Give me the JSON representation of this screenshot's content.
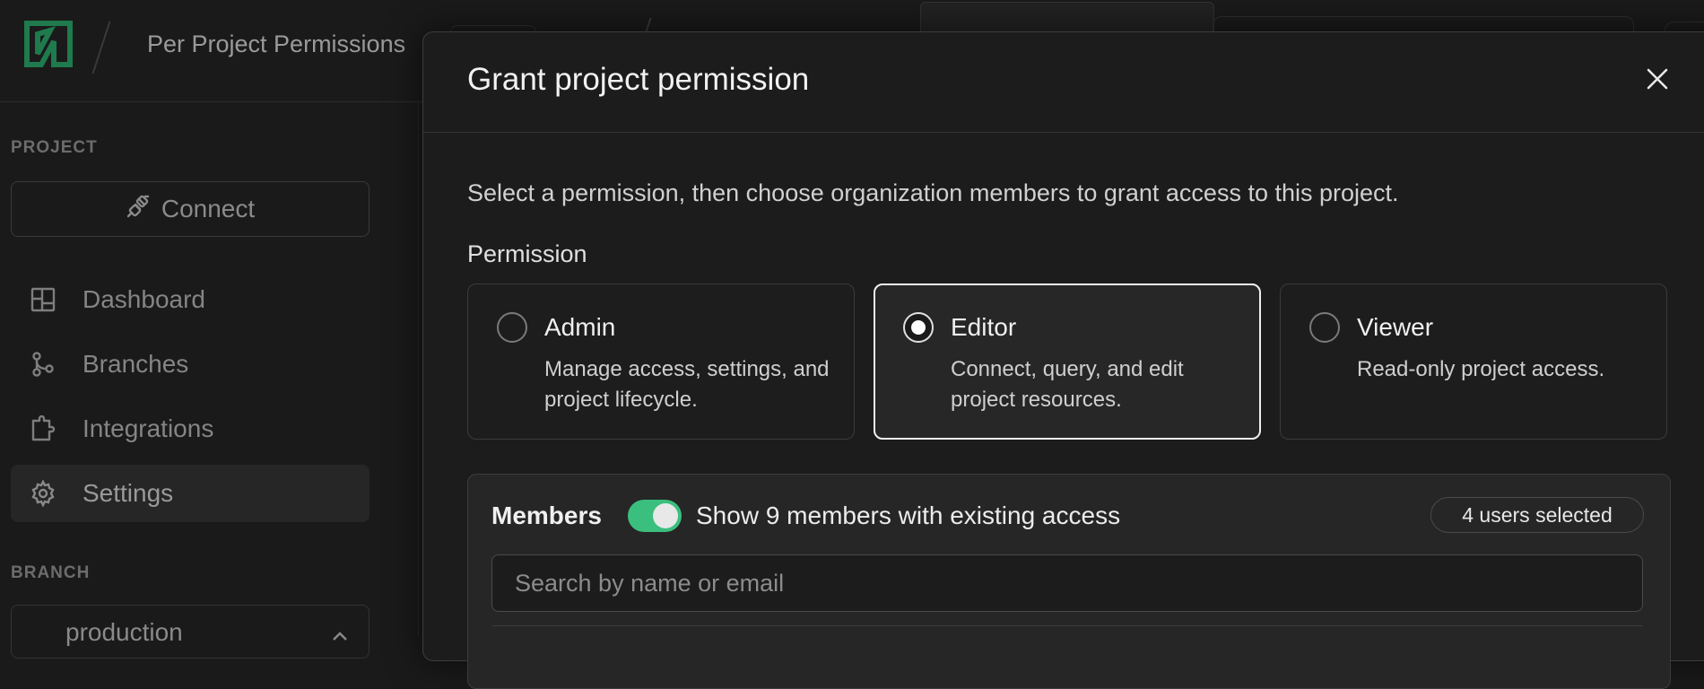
{
  "header": {
    "project_name": "Per Project Permissions"
  },
  "sidebar": {
    "project_section": "PROJECT",
    "connect_label": "Connect",
    "items": [
      {
        "label": "Dashboard",
        "icon": "dashboard-icon"
      },
      {
        "label": "Branches",
        "icon": "branches-icon"
      },
      {
        "label": "Integrations",
        "icon": "integrations-icon"
      },
      {
        "label": "Settings",
        "icon": "gear-icon",
        "active": true
      }
    ],
    "branch_section": "BRANCH",
    "branch_name": "production"
  },
  "modal": {
    "title": "Grant project permission",
    "description": "Select a permission, then choose organization members to grant access to this project.",
    "permission_label": "Permission",
    "options": [
      {
        "title": "Admin",
        "description": "Manage access, settings, and project lifecycle.",
        "selected": false
      },
      {
        "title": "Editor",
        "description": "Connect, query, and edit project resources.",
        "selected": true
      },
      {
        "title": "Viewer",
        "description": "Read-only project access.",
        "selected": false
      }
    ],
    "members": {
      "label": "Members",
      "toggle_on": true,
      "toggle_label": "Show 9 members with existing access",
      "selected_badge": "4 users selected",
      "search_placeholder": "Search by name or email",
      "search_value": ""
    }
  },
  "colors": {
    "accent_green": "#3bbf7e",
    "logo_green": "#1f7a4d",
    "background": "#1a1a1a"
  }
}
